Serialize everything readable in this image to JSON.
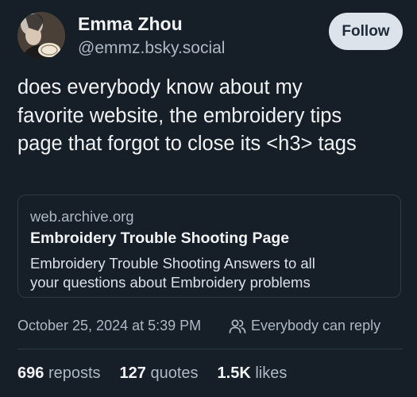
{
  "author": {
    "display_name": "Emma Zhou",
    "handle": "@emmz.bsky.social"
  },
  "follow_button": {
    "label": "Follow"
  },
  "post": {
    "text_lines": [
      "does everybody know about my",
      "favorite website, the embroidery tips",
      "page that forgot to close its <h3> tags"
    ]
  },
  "link_card": {
    "domain": "web.archive.org",
    "title": "Embroidery Trouble Shooting Page",
    "description_lines": [
      "Embroidery Trouble Shooting Answers to all",
      "your questions about Embroidery problems"
    ]
  },
  "meta": {
    "timestamp": "October 25, 2024 at 5:39 PM",
    "reply_setting": "Everybody can reply",
    "reply_icon": "people-icon"
  },
  "stats": {
    "reposts": {
      "count": "696",
      "label": "reposts"
    },
    "quotes": {
      "count": "127",
      "label": "quotes"
    },
    "likes": {
      "count": "1.5K",
      "label": "likes"
    }
  },
  "colors": {
    "background": "#161e27",
    "primary_text": "#f1f3f5",
    "secondary_text": "#aeb9c5",
    "follow_button_bg": "#dde3ea",
    "border": "#2e3a48"
  }
}
